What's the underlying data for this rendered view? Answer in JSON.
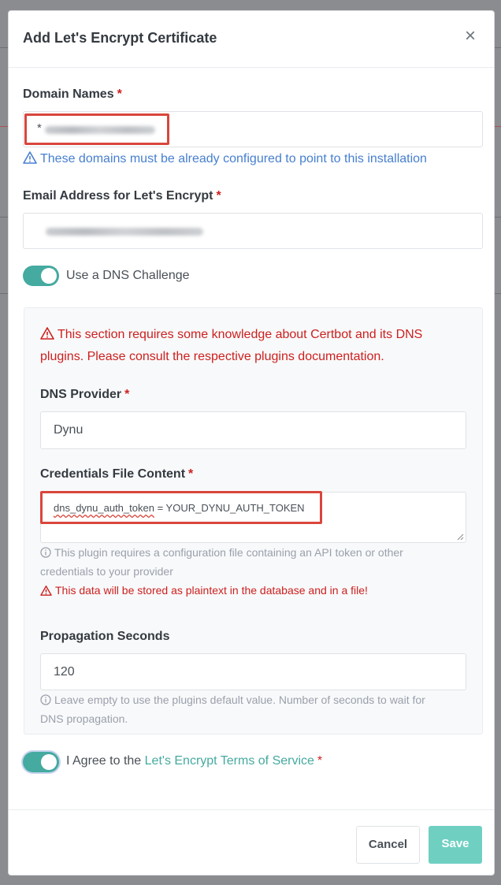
{
  "modal": {
    "title": "Add Let's Encrypt Certificate",
    "close_symbol": "×"
  },
  "domain": {
    "label": "Domain Names",
    "required_mark": "*",
    "value_prefix": "*",
    "hint": "These domains must be already configured to point to this installation"
  },
  "email": {
    "label": "Email Address for Let's Encrypt",
    "required_mark": "*"
  },
  "dns_toggle": {
    "label": "Use a DNS Challenge",
    "on": true
  },
  "dns_section": {
    "warning_line1": "This section requires some knowledge about Certbot and its DNS",
    "warning_line2": "plugins. Please consult the respective plugins documentation.",
    "provider": {
      "label": "DNS Provider",
      "required_mark": "*",
      "value": "Dynu"
    },
    "credentials": {
      "label": "Credentials File Content",
      "required_mark": "*",
      "key": "dns_dynu_auth_token",
      "rest": " = YOUR_DYNU_AUTH_TOKEN",
      "help_line1": "This plugin requires a configuration file containing an API token or other",
      "help_line2": "credentials to your provider",
      "plaintext_warning": "This data will be stored as plaintext in the database and in a file!"
    },
    "propagation": {
      "label": "Propagation Seconds",
      "value": "120",
      "help_line1": "Leave empty to use the plugins default value. Number of seconds to wait for",
      "help_line2": "DNS propagation."
    }
  },
  "agree": {
    "prefix": "I Agree to the",
    "link": "Let's Encrypt Terms of Service",
    "required_mark": "*",
    "on": true
  },
  "buttons": {
    "cancel": "Cancel",
    "save": "Save"
  },
  "colors": {
    "teal": "#45aaa0",
    "red": "#cd201f",
    "blue": "#467fcf",
    "save_bg": "#6fd0c2"
  }
}
